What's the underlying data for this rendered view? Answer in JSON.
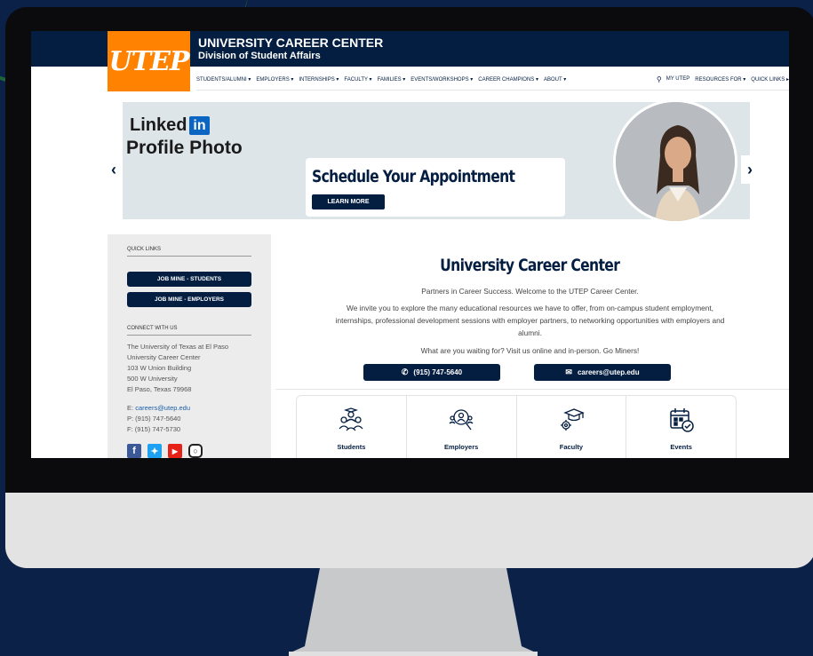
{
  "header": {
    "logo_text": "UTEP",
    "title": "UNIVERSITY CAREER CENTER",
    "subtitle": "Division of Student Affairs"
  },
  "nav": {
    "items": [
      "STUDENTS/ALUMNI ▾",
      "EMPLOYERS ▾",
      "INTERNSHIPS ▾",
      "FACULTY ▾",
      "FAMILIES ▾",
      "EVENTS/WORKSHOPS ▾",
      "CAREER CHAMPIONS ▾",
      "ABOUT ▾"
    ],
    "right_items": [
      "MY UTEP",
      "RESOURCES FOR ▾",
      "QUICK LINKS ▸"
    ]
  },
  "banner": {
    "linkedin_word": "Linked",
    "linkedin_in": "in",
    "linkedin_sub": "Profile Photo",
    "appointment_title": "Schedule Your Appointment",
    "learn_more": "LEARN MORE"
  },
  "sidebar": {
    "quick_links_heading": "QUICK LINKS",
    "btn_students": "JOB MINE - STUDENTS",
    "btn_employers": "JOB MINE - EMPLOYERS",
    "connect_heading": "CONNECT WITH US",
    "address": [
      "The University of Texas at El Paso",
      "University Career Center",
      "103 W Union Building",
      "500 W University",
      "El Paso, Texas 79968"
    ],
    "email_label": "E:",
    "email": "careers@utep.edu",
    "phone": "P: (915) 747-5640",
    "fax": "F: (915) 747-5730"
  },
  "main": {
    "title": "University Career Center",
    "tagline": "Partners in Career Success. Welcome to the UTEP Career Center.",
    "intro": "We invite you to explore the many educational resources we have to offer, from on-campus student employment, internships, professional development sessions with employer partners, to networking opportunities with employers and alumni.",
    "cta": "What are you waiting for? Visit us online and in-person. Go Miners!",
    "phone_btn": "(915) 747-5640",
    "email_btn": "careers@utep.edu",
    "cards": [
      "Students",
      "Employers",
      "Faculty",
      "Events"
    ]
  },
  "colors": {
    "navy": "#041e42",
    "orange": "#ff8200",
    "linkedin": "#0a66c2"
  }
}
